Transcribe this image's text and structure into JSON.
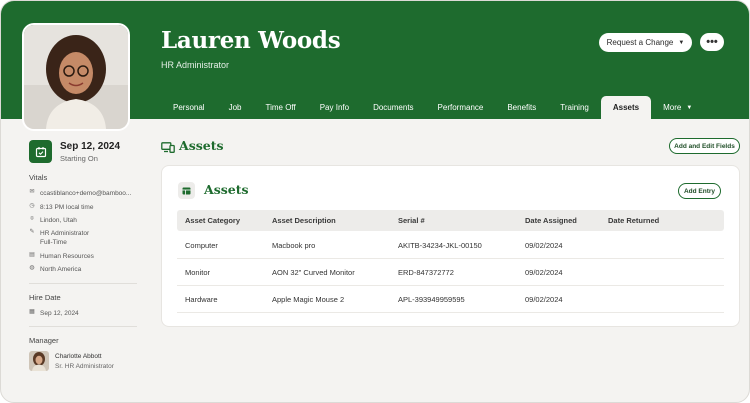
{
  "header": {
    "name": "Lauren Woods",
    "job_title": "HR Administrator",
    "request_button": "Request a Change",
    "more_button": "•••",
    "tabs": [
      {
        "label": "Personal"
      },
      {
        "label": "Job"
      },
      {
        "label": "Time Off"
      },
      {
        "label": "Pay Info"
      },
      {
        "label": "Documents"
      },
      {
        "label": "Performance"
      },
      {
        "label": "Benefits"
      },
      {
        "label": "Training"
      },
      {
        "label": "Assets",
        "active": true
      },
      {
        "label": "More"
      }
    ]
  },
  "sidebar": {
    "start_date": "Sep 12, 2024",
    "start_label": "Starting On",
    "vitals_heading": "Vitals",
    "vitals": {
      "email": "ccastiblanco+demo@bamboo...",
      "local_time": "8:13 PM local time",
      "location": "Lindon, Utah",
      "role": "HR Administrator",
      "employment": "Full-Time",
      "department": "Human Resources",
      "region": "North America"
    },
    "hire_heading": "Hire Date",
    "hire_date": "Sep 12, 2024",
    "manager_heading": "Manager",
    "manager_name": "Charlotte Abbott",
    "manager_title": "Sr. HR Administrator"
  },
  "main": {
    "section_title": "Assets",
    "add_edit_fields": "Add and Edit Fields",
    "card_title": "Assets",
    "add_entry": "Add Entry",
    "columns": [
      "Asset Category",
      "Asset Description",
      "Serial #",
      "Date Assigned",
      "Date Returned"
    ],
    "rows": [
      {
        "category": "Computer",
        "description": "Macbook pro",
        "serial": "AKITB-34234-JKL-00150",
        "assigned": "09/02/2024",
        "returned": ""
      },
      {
        "category": "Monitor",
        "description": "AON 32\" Curved Monitor",
        "serial": "ERD-847372772",
        "assigned": "09/02/2024",
        "returned": ""
      },
      {
        "category": "Hardware",
        "description": "Apple Magic Mouse 2",
        "serial": "APL-393949959595",
        "assigned": "09/02/2024",
        "returned": ""
      }
    ]
  },
  "colors": {
    "brand_green": "#1e6b2e",
    "background": "#f4f3f1"
  }
}
